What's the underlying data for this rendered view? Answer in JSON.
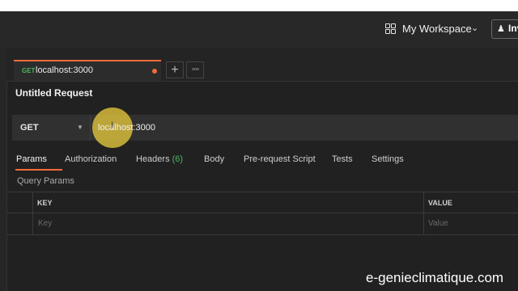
{
  "header": {
    "workspace_label": "My Workspace",
    "invite_label": "Inv"
  },
  "tab": {
    "method": "GET",
    "url": "localhost:3000"
  },
  "request": {
    "title": "Untitled Request",
    "method": "GET",
    "url": "localhost:3000"
  },
  "subtabs": {
    "params": "Params",
    "authorization": "Authorization",
    "headers": "Headers",
    "headers_count": "(6)",
    "body": "Body",
    "prerequest": "Pre-request Script",
    "tests": "Tests",
    "settings": "Settings"
  },
  "query_params": {
    "label": "Query Params",
    "key_header": "KEY",
    "value_header": "VALUE",
    "key_placeholder": "Key",
    "value_placeholder": "Value"
  },
  "watermark": "e-genieclimatique.com",
  "colors": {
    "accent": "#f26b3a",
    "method_green": "#49b85c",
    "cursor_highlight": "#e6c83c"
  },
  "icons": {
    "workspace": "grid-icon",
    "workspace_chevron": "chevron-down-icon",
    "invite": "user-plus-icon",
    "add_tab": "plus-icon",
    "more_tabs": "ellipsis-icon",
    "method_caret": "caret-down-icon"
  }
}
